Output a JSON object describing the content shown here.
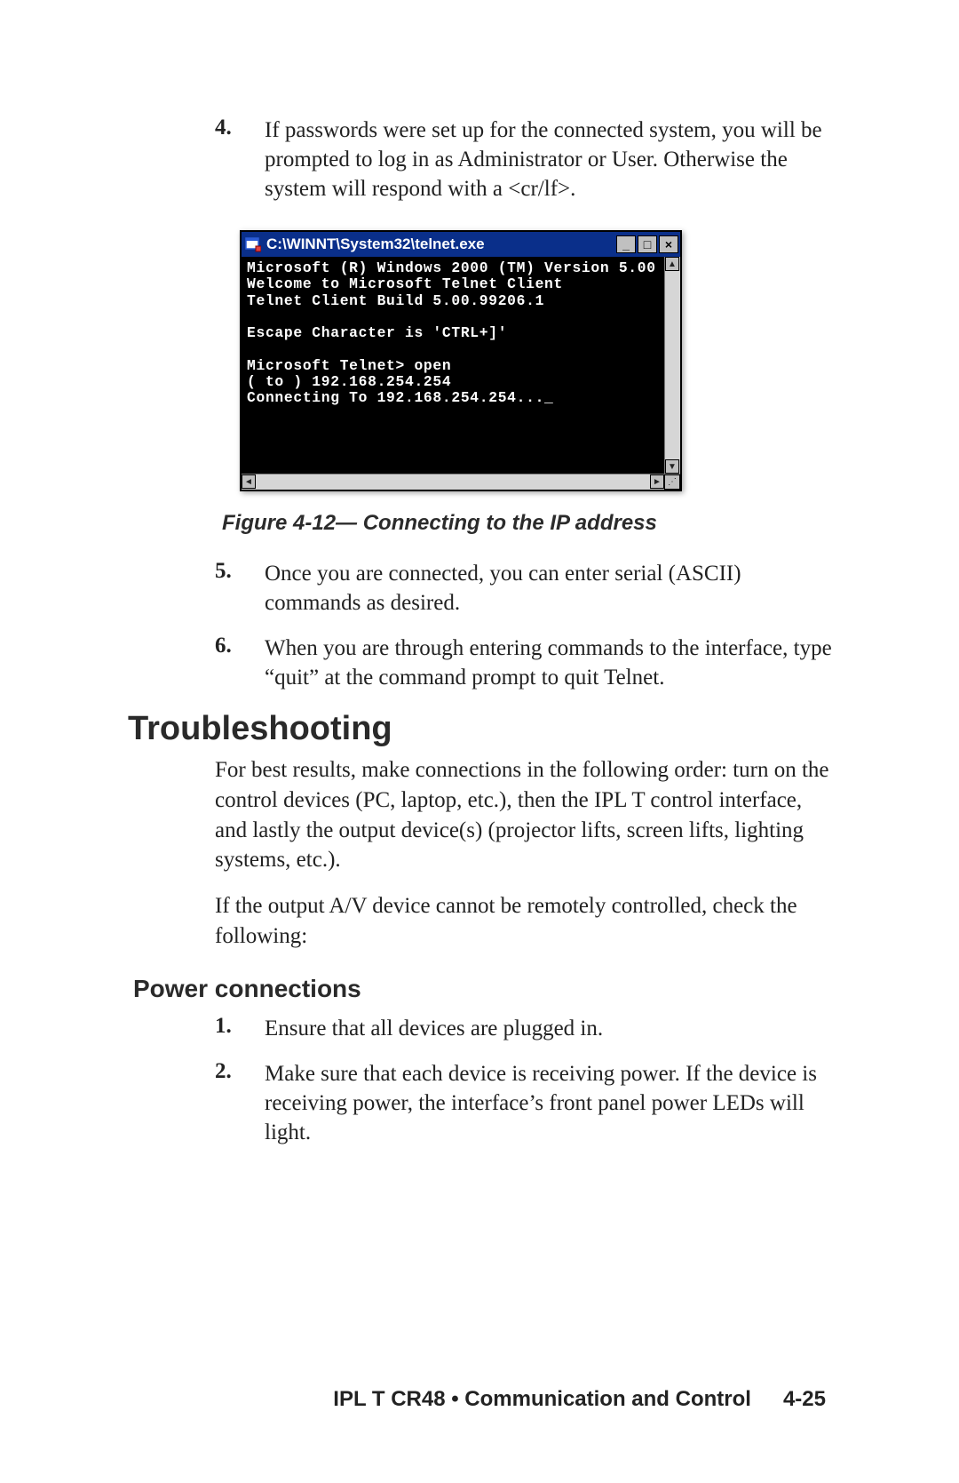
{
  "steps_top": [
    {
      "num": "4.",
      "text": "If passwords were set up for the connected system, you will be prompted to log in as Administrator or User. Otherwise the system will respond with a <cr/lf>."
    }
  ],
  "telnet": {
    "title": "C:\\WINNT\\System32\\telnet.exe",
    "btn_min": "_",
    "btn_max": "□",
    "btn_close": "×",
    "scroll_up": "▲",
    "scroll_down": "▼",
    "scroll_left": "◄",
    "scroll_right": "►",
    "body": "Microsoft (R) Windows 2000 (TM) Version 5.00\nWelcome to Microsoft Telnet Client\nTelnet Client Build 5.00.99206.1\n\nEscape Character is 'CTRL+]'\n\nMicrosoft Telnet> open\n( to ) 192.168.254.254\nConnecting To 192.168.254.254..._"
  },
  "figure_caption": "Figure 4-12— Connecting to the IP address",
  "steps_mid": [
    {
      "num": "5.",
      "text": "Once you are connected, you can enter serial (ASCII) commands as desired."
    },
    {
      "num": "6.",
      "text": "When you are through entering commands to the interface, type “quit” at the command prompt to quit Telnet."
    }
  ],
  "section_title": "Troubleshooting",
  "trouble_p1": "For best results, make connections in the following order: turn on the control devices (PC, laptop, etc.), then the IPL T control interface, and lastly the output device(s) (projector lifts, screen lifts, lighting systems, etc.).",
  "trouble_p2": "If the output A/V device cannot be remotely controlled, check the following:",
  "subsection_title": "Power connections",
  "steps_power": [
    {
      "num": "1.",
      "text": "Ensure that all devices are plugged in."
    },
    {
      "num": "2.",
      "text": "Make sure that each device is receiving power.  If the device is receiving power, the interface’s front panel power LEDs will light."
    }
  ],
  "footer": {
    "text": "IPL T CR48 • Communication and Control",
    "page": "4-25"
  }
}
